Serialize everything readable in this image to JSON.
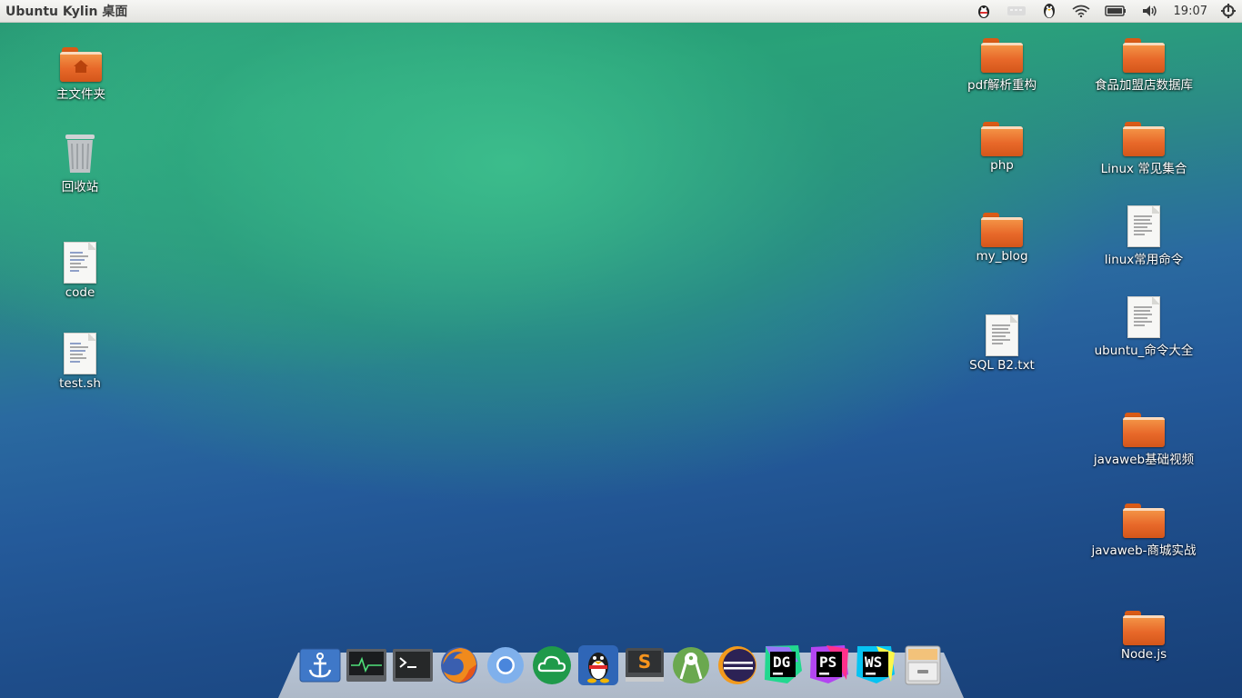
{
  "topbar": {
    "title": "Ubuntu Kylin 桌面",
    "clock": "19:07",
    "tray_icons": [
      "qq-penguin-icon",
      "input-method-icon",
      "penguin-icon",
      "wifi-icon",
      "battery-icon",
      "volume-icon",
      "power-gear-icon"
    ]
  },
  "desktop": {
    "left": [
      {
        "label": "主文件夹",
        "icon": "home-folder-icon"
      },
      {
        "label": "回收站",
        "icon": "trash-icon"
      },
      {
        "label": "code",
        "icon": "text-file-icon"
      },
      {
        "label": "test.sh",
        "icon": "script-file-icon"
      }
    ],
    "right_col1": [
      {
        "label": "pdf解析重构",
        "icon": "folder-icon"
      },
      {
        "label": "php",
        "icon": "folder-icon"
      },
      {
        "label": "my_blog",
        "icon": "folder-icon"
      },
      {
        "label": "SQL B2.txt",
        "icon": "text-file-icon"
      }
    ],
    "right_col2": [
      {
        "label": "食品加盟店数据库",
        "icon": "folder-icon"
      },
      {
        "label": "Linux 常见集合",
        "icon": "folder-icon"
      },
      {
        "label": "linux常用命令",
        "icon": "text-file-icon"
      },
      {
        "label": "ubuntu_命令大全",
        "icon": "text-file-icon"
      },
      {
        "label": "javaweb基础视频",
        "icon": "folder-icon"
      },
      {
        "label": "javaweb-商城实战",
        "icon": "folder-icon"
      },
      {
        "label": "Node.js",
        "icon": "folder-icon"
      }
    ]
  },
  "dock": {
    "apps": [
      {
        "name": "anchor-launcher-icon",
        "text": ""
      },
      {
        "name": "system-monitor-icon",
        "text": ""
      },
      {
        "name": "terminal-icon",
        "text": ""
      },
      {
        "name": "firefox-icon",
        "text": ""
      },
      {
        "name": "chromium-icon",
        "text": ""
      },
      {
        "name": "cloud-icon",
        "text": ""
      },
      {
        "name": "qq-icon",
        "text": ""
      },
      {
        "name": "sublime-text-icon",
        "text": ""
      },
      {
        "name": "android-studio-icon",
        "text": ""
      },
      {
        "name": "eclipse-icon",
        "text": ""
      },
      {
        "name": "datagrip-icon",
        "text": "DG"
      },
      {
        "name": "phpstorm-icon",
        "text": "PS"
      },
      {
        "name": "webstorm-icon",
        "text": "WS"
      },
      {
        "name": "file-cabinet-icon",
        "text": ""
      }
    ]
  }
}
